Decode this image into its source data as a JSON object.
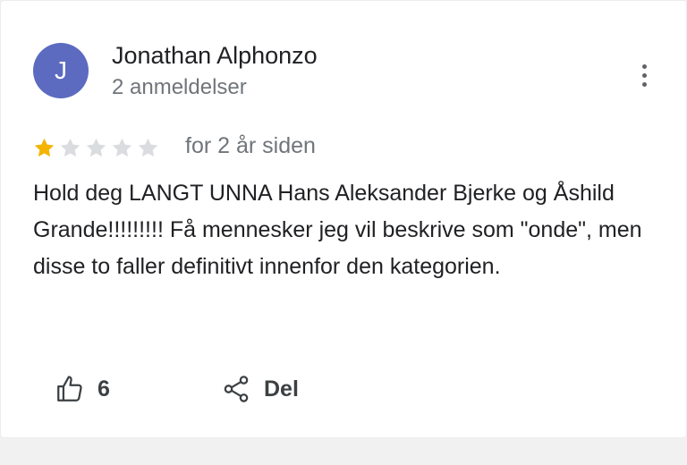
{
  "review": {
    "author": {
      "initial": "J",
      "name": "Jonathan Alphonzo",
      "review_count": "2 anmeldelser",
      "avatar_color": "#5c6bc0"
    },
    "rating": 1,
    "max_rating": 5,
    "time_ago": "for 2 år siden",
    "text": "Hold deg LANGT UNNA Hans Aleksander Bjerke og Åshild Grande!!!!!!!!! Få mennesker jeg vil beskrive som \"onde\", men disse to faller definitivt innenfor den kategorien.",
    "actions": {
      "like_icon": "thumb-up-icon",
      "like_count": "6",
      "share_icon": "share-icon",
      "share_label": "Del"
    },
    "menu_icon": "more-vert-icon"
  },
  "colors": {
    "star_filled": "#f4b400",
    "star_empty": "#dadce0"
  }
}
